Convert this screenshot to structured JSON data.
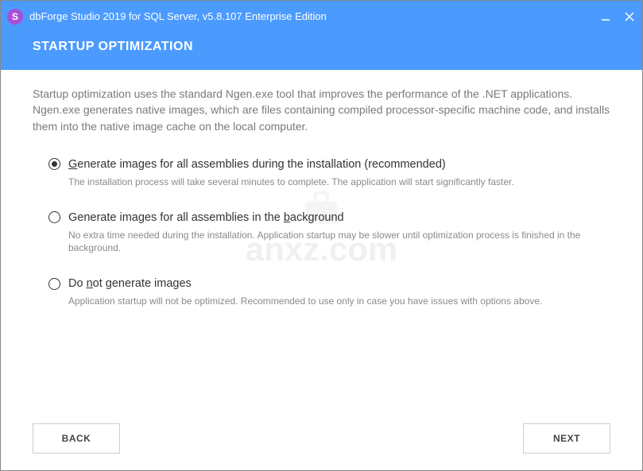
{
  "titlebar": {
    "icon_letter": "S",
    "title": "dbForge Studio 2019 for SQL Server, v5.8.107 Enterprise Edition"
  },
  "header": {
    "title": "STARTUP OPTIMIZATION"
  },
  "description": "Startup optimization uses the standard Ngen.exe tool that improves the performance of the .NET applications. Ngen.exe generates native images, which are files containing compiled processor-specific machine code, and installs them into the native image cache on the local computer.",
  "options": [
    {
      "selected": true,
      "label_prefix": "",
      "label_hotkey": "G",
      "label_rest": "enerate images for all assemblies during the installation (recommended)",
      "desc": "The installation process will take several minutes to complete. The application will start significantly faster."
    },
    {
      "selected": false,
      "label_prefix": "Generate images for all assemblies in the ",
      "label_hotkey": "b",
      "label_rest": "ackground",
      "desc": "No extra time needed during the installation. Application startup may be slower until optimization process is finished in the background."
    },
    {
      "selected": false,
      "label_prefix": "Do ",
      "label_hotkey": "n",
      "label_rest": "ot generate images",
      "desc": "Application startup will not be optimized. Recommended to use only in case you have issues with options above."
    }
  ],
  "footer": {
    "back_label": "BACK",
    "next_label": "NEXT"
  },
  "watermark": "anxz.com"
}
